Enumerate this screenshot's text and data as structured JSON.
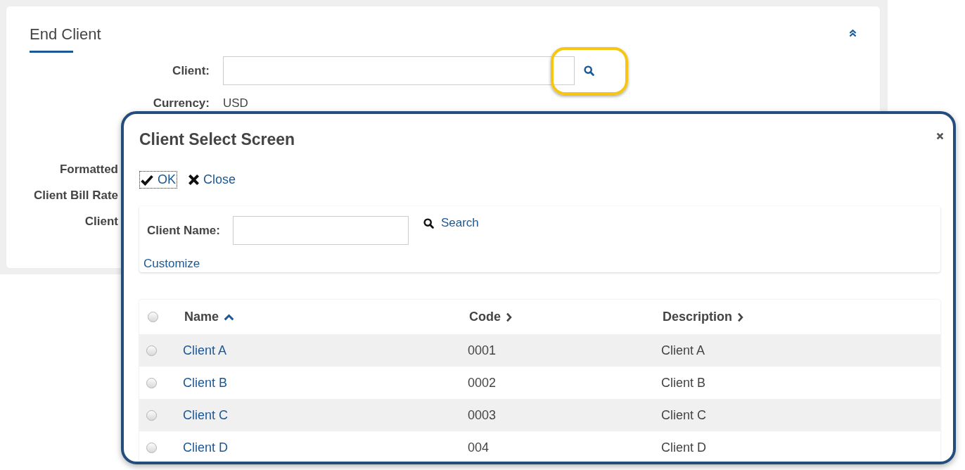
{
  "end_client": {
    "title": "End Client",
    "expanded": true,
    "fields": [
      {
        "kind": "lookup",
        "label": "Client:",
        "highlighted": true
      },
      {
        "kind": "display",
        "label": "Currency:",
        "value": "USD"
      }
    ],
    "covered_fields": [
      {
        "label": "Formatted"
      },
      {
        "label": "Client Bill Rate"
      },
      {
        "label": "Client"
      }
    ]
  },
  "dialog": {
    "title": "Client Select Screen",
    "actions": [
      {
        "kind": "ok",
        "label": "OK",
        "focused": true
      },
      {
        "kind": "close",
        "label": "Close",
        "focused": false
      }
    ],
    "search": {
      "label": "Client Name:",
      "button": "Search",
      "link": "Customize"
    },
    "table": {
      "all_selected": false,
      "columns": [
        {
          "label": "Name",
          "sorted": true
        },
        {
          "label": "Code",
          "sorted": false
        },
        {
          "label": "Description",
          "sorted": false
        }
      ],
      "rows": [
        {
          "selected": false,
          "cells": [
            "Client A",
            "0001",
            "Client A"
          ]
        },
        {
          "selected": false,
          "cells": [
            "Client B",
            "0002",
            "Client B"
          ]
        },
        {
          "selected": false,
          "cells": [
            "Client C",
            "0003",
            "Client C"
          ]
        },
        {
          "selected": false,
          "cells": [
            "Client D",
            "004",
            "Client D"
          ]
        }
      ]
    }
  }
}
